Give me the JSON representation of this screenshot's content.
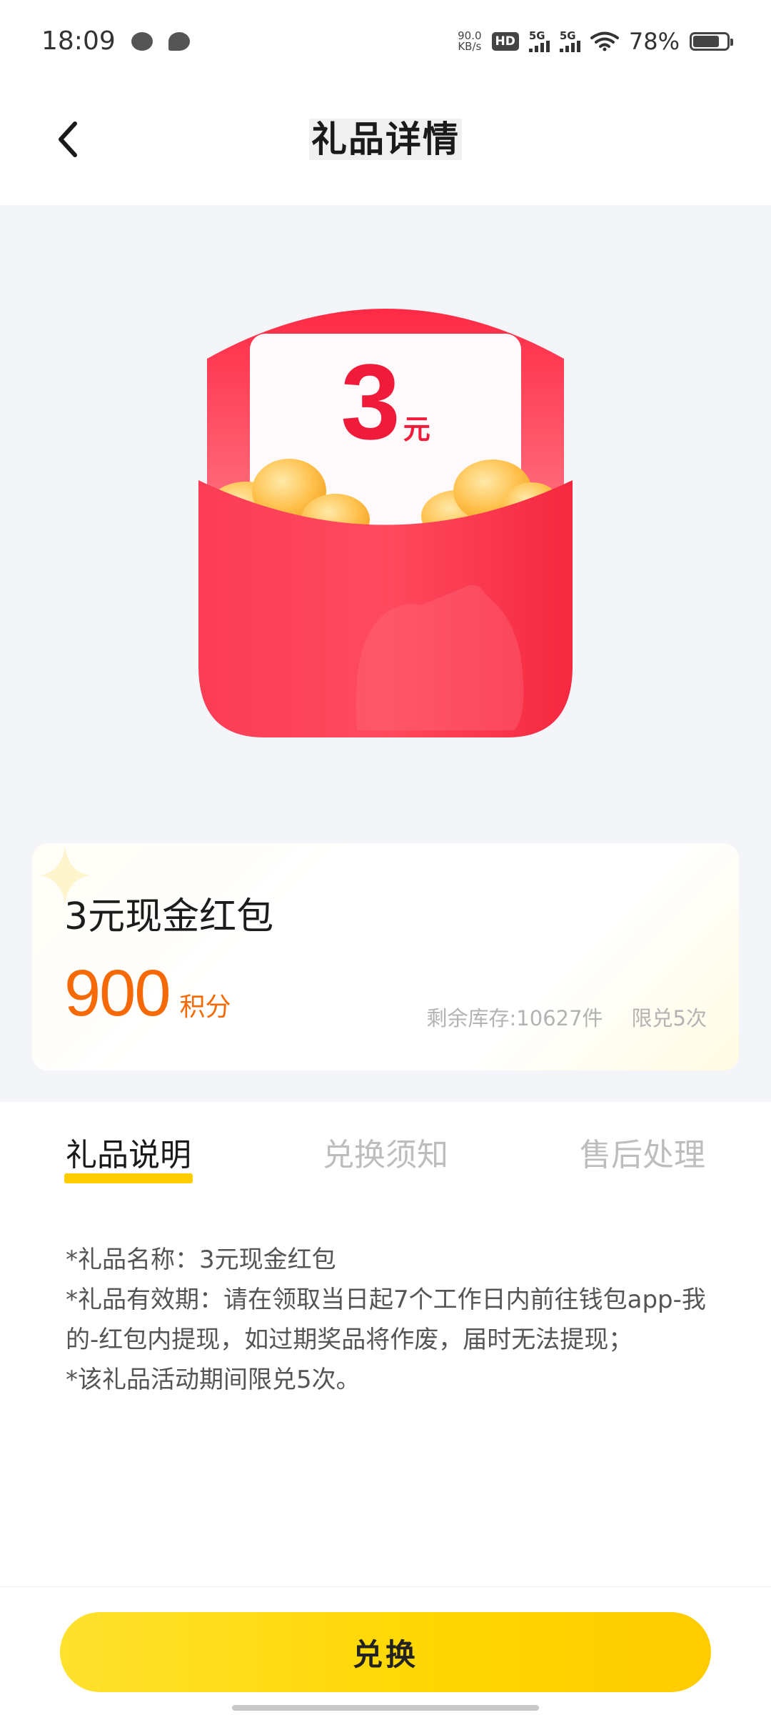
{
  "status_bar": {
    "time": "18:09",
    "net_speed_value": "90.0",
    "net_speed_unit": "KB/s",
    "hd_label": "HD",
    "sim1_label": "5G",
    "sim2_label": "5G",
    "battery_percent": "78%",
    "battery_level": 0.78
  },
  "header": {
    "title": "礼品详情",
    "back_icon": "chevron-left-icon"
  },
  "hero": {
    "amount": "3",
    "unit": "元"
  },
  "product": {
    "name": "3元现金红包",
    "points": "900",
    "points_unit": "积分",
    "stock": "剩余库存:10627件",
    "limit": "限兑5次"
  },
  "tabs": [
    {
      "label": "礼品说明",
      "active": true
    },
    {
      "label": "兑换须知",
      "active": false
    },
    {
      "label": "售后处理",
      "active": false
    }
  ],
  "description": [
    "*礼品名称：3元现金红包",
    "*礼品有效期：请在领取当日起7个工作日内前往钱包app-我的-红包内提现，如过期奖品将作废，届时无法提现；",
    "*该礼品活动期间限兑5次。"
  ],
  "actions": {
    "exchange_label": "兑换"
  },
  "colors": {
    "accent_yellow": "#ffcc00",
    "price_orange": "#f56a06",
    "envelope_red": "#f01b3a"
  }
}
